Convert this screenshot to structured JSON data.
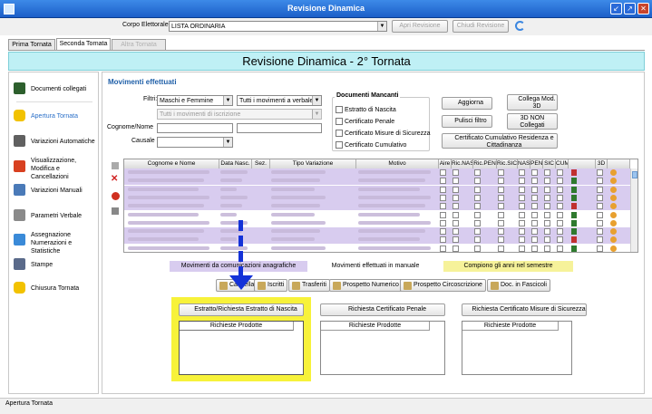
{
  "window": {
    "title": "Revisione Dinamica"
  },
  "toolbar": {
    "corpo_label": "Corpo Elettorale",
    "corpo_value": "LISTA ORDINARIA",
    "apri_label": "Apri Revisione",
    "chiudi_label": "Chiudi Revisione"
  },
  "tabs": [
    {
      "label": "Prima Tornata"
    },
    {
      "label": "Seconda Tornata"
    },
    {
      "label": "Altra Tornata"
    }
  ],
  "header": {
    "title": "Revisione Dinamica - 2° Tornata"
  },
  "sidebar": {
    "items": [
      {
        "label": "Documenti collegati",
        "icon": "document-icon"
      },
      {
        "label": "Apertura Tornata",
        "icon": "lock-open-icon"
      },
      {
        "label": "Variazioni Automatiche",
        "icon": "wand-icon"
      },
      {
        "label": "Visualizzazione, Modifica e Cancellazioni",
        "icon": "edit-icon"
      },
      {
        "label": "Variazioni Manuali",
        "icon": "pencil-icon"
      },
      {
        "label": "Parametri Verbale",
        "icon": "wrench-icon"
      },
      {
        "label": "Assegnazione Numerazioni e Statistiche",
        "icon": "table-icon"
      },
      {
        "label": "Stampe",
        "icon": "printer-icon"
      },
      {
        "label": "Chiusura Tornata",
        "icon": "lock-icon"
      }
    ]
  },
  "main": {
    "section_title": "Movimenti effettuati",
    "filtri_label": "Filtri:",
    "filtro_sesso": "Maschi e Femmine",
    "filtro_movimenti": "Tutti i movimenti a verbale",
    "filtro_iscrizione": "Tutti i movimenti di iscrizione",
    "cognome_label": "Cognome/Nome",
    "causale_label": "Causale",
    "doc_mancanti": {
      "title": "Documenti Mancanti",
      "items": [
        "Estratto di Nascita",
        "Certificato Penale",
        "Certificato Misure di Sicurezza",
        "Certificato Cumulativo"
      ]
    },
    "buttons": {
      "aggiorna": "Aggiorna",
      "collega": "Collega Mod. 3D",
      "pulisci": "Pulisci filtro",
      "nonc": "3D NON Collegati",
      "cert_cum": "Certificato Cumulativo Residenza e Cittadinanza"
    },
    "grid": {
      "columns": [
        "Cognome e Nome",
        "Data Nasc.",
        "Sez.",
        "Tipo Variazione",
        "Motivo",
        "Aire",
        "Ric.NAS",
        "Ric.PEN",
        "Ric.SIC",
        "NAS",
        "PEN",
        "SIC",
        "CUM",
        "3D"
      ]
    },
    "legend": {
      "comunicazioni": "Movimenti da comunicazioni anagrafiche",
      "manuale": "Movimenti effettuati in manuale",
      "compiono": "Compiono gli anni nel semestre"
    },
    "actions": [
      "Cancellati",
      "Iscritti",
      "Trasferiti",
      "Prospetto Numerico",
      "Prospetto Circoscrizione",
      "Doc. in Fascicoli"
    ],
    "richieste": [
      {
        "button": "Estratto/Richiesta Estratto di Nascita",
        "header": "Richieste Prodotte"
      },
      {
        "button": "Richiesta Certificato Penale",
        "header": "Richieste Prodotte"
      },
      {
        "button": "Richiesta Certificato Misure di Sicurezza",
        "header": "Richieste Prodotte"
      }
    ]
  },
  "status": {
    "text": "Apertura Tornata"
  },
  "colors": {
    "title_blue": "#1c5fc8",
    "header_cyan": "#bff0f5",
    "legend_purple": "#d8ccef",
    "legend_yellow": "#f6f29a",
    "highlight_yellow": "#f7f23a",
    "arrow_blue": "#1432d8"
  }
}
